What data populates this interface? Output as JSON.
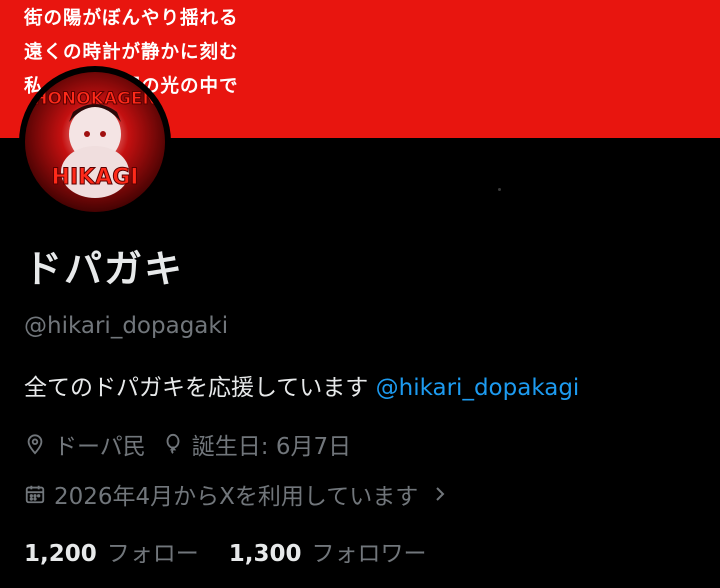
{
  "banner": {
    "color": "#e8150f",
    "lines": [
      "街の陽がぼんやり揺れる",
      "遠くの時計が静かに刻む",
      "私　　　　朝の光の中で"
    ]
  },
  "avatar": {
    "text_top": "HONOKAGEN",
    "text_bottom": "HIKAGI"
  },
  "profile": {
    "display_name": "ドパガキ",
    "handle": "@hikari_dopagaki",
    "bio_text": "全てのドパガキを応援しています ",
    "bio_mention": "@hikari_dopakagi",
    "location": "ドーパ民",
    "birthday": "誕生日: 6月7日",
    "joined": "2026年4月からXを利用しています"
  },
  "stats": {
    "following_count": "1,200",
    "following_label": "フォロー",
    "followers_count": "1,300",
    "followers_label": "フォロワー"
  },
  "colors": {
    "link": "#1d9bf0",
    "muted": "#71767b",
    "text": "#e7e9ea"
  }
}
